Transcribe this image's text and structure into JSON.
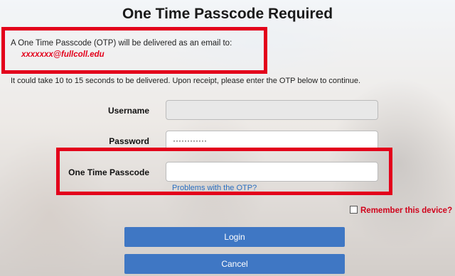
{
  "header": {
    "title": "One Time Passcode Required"
  },
  "delivery": {
    "notice": "A One Time Passcode (OTP) will be delivered as an email to:",
    "email": "xxxxxxx@fullcoll.edu"
  },
  "instructions": "It could take 10 to 15 seconds to be delivered. Upon receipt, please enter the OTP below to continue.",
  "form": {
    "username_label": "Username",
    "username_value": "",
    "password_label": "Password",
    "password_value": "············",
    "otp_label": "One Time Passcode",
    "otp_value": "",
    "otp_help_link": "Problems with the OTP?",
    "remember_label": "Remember this device?",
    "remember_checked": false,
    "login_label": "Login",
    "cancel_label": "Cancel"
  },
  "colors": {
    "accent": "#3f77c4",
    "highlight": "#e3001b",
    "link": "#2a6fc0"
  }
}
